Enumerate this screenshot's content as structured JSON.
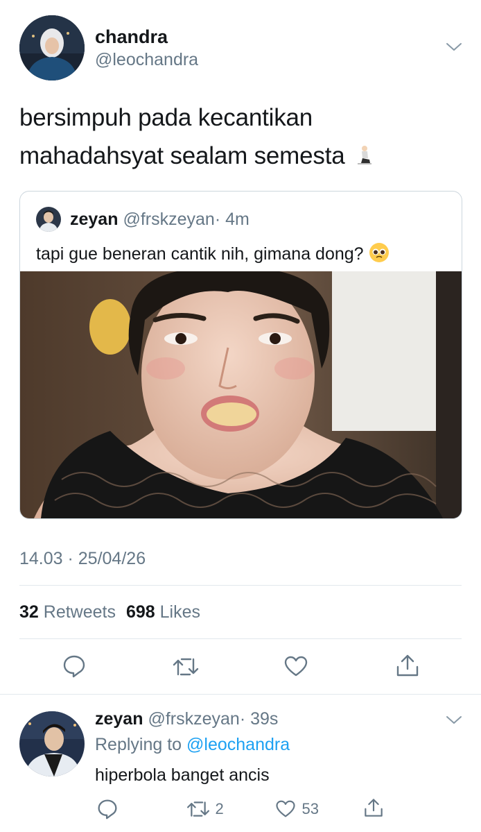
{
  "tweet": {
    "author": {
      "name": "chandra",
      "handle": "@leochandra"
    },
    "text_line1": "bersimpuh pada kecantikan",
    "text_line2": "mahadahsyat sealam semesta",
    "emoji": "kneeling-person",
    "quoted": {
      "name": "zeyan",
      "handle": "@frskzeyan",
      "time": "· 4m",
      "text": "tapi gue beneran cantik nih, gimana dong?",
      "emoji": "pleading-face"
    },
    "timestamp": "14.03 · 25/04/26",
    "stats": {
      "retweets_count": "32",
      "retweets_label": "Retweets",
      "likes_count": "698",
      "likes_label": "Likes"
    }
  },
  "reply": {
    "name": "zeyan",
    "handle": "@frskzeyan",
    "time": "· 39s",
    "replying_prefix": "Replying to",
    "replying_to": "@leochandra",
    "text": "hiperbola banget ancis",
    "retweets": "2",
    "likes": "53"
  },
  "colors": {
    "accent": "#1da1f2",
    "muted": "#657786",
    "divider": "#e1e8ed"
  }
}
